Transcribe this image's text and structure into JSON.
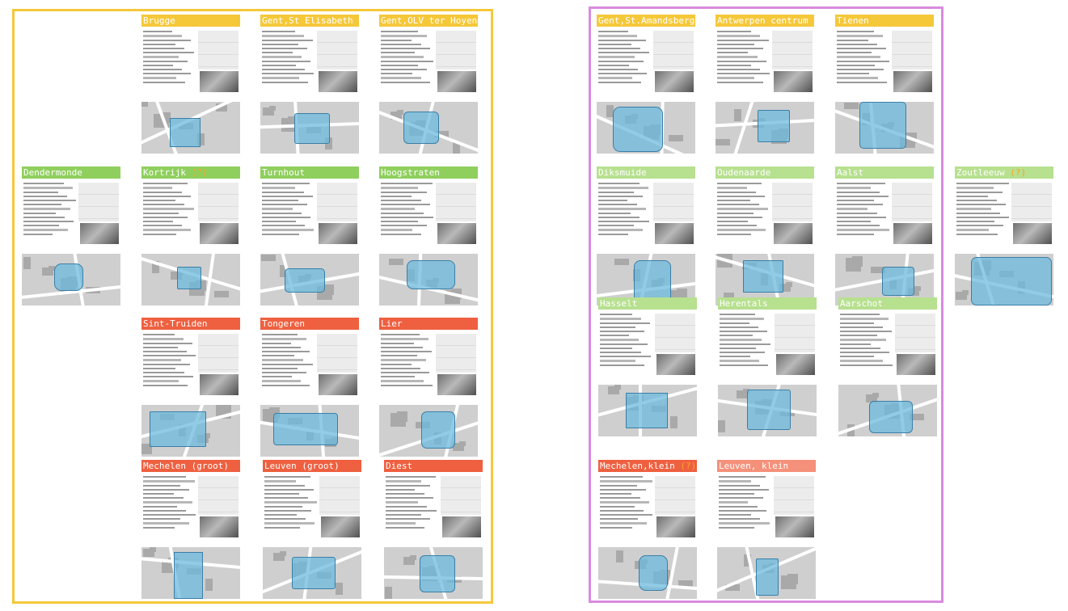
{
  "colors": {
    "yellow": "#f5c83a",
    "green": "#8fcf5e",
    "lightgreen": "#b7e08f",
    "red": "#ee6040",
    "salmon": "#f5907a",
    "frame_left": "#f5c83a",
    "frame_right": "#d98be0",
    "question": "#f5a623"
  },
  "cards": [
    {
      "name": "Brugge",
      "q": "",
      "color": "yellow"
    },
    {
      "name": "Gent,St Elisabeth",
      "q": "",
      "color": "yellow"
    },
    {
      "name": "Gent,OLV ter Hoyen",
      "q": "",
      "color": "yellow"
    },
    {
      "name": "Dendermonde",
      "q": "",
      "color": "green"
    },
    {
      "name": "Kortrijk ",
      "q": "(?)",
      "color": "green"
    },
    {
      "name": "Turnhout",
      "q": "",
      "color": "green"
    },
    {
      "name": "Hoogstraten",
      "q": "",
      "color": "green"
    },
    {
      "name": "Sint-Truiden",
      "q": "",
      "color": "red"
    },
    {
      "name": "Tongeren",
      "q": "",
      "color": "red"
    },
    {
      "name": "Lier",
      "q": "",
      "color": "red"
    },
    {
      "name": "Mechelen (groot)",
      "q": "",
      "color": "red"
    },
    {
      "name": "Leuven (groot)",
      "q": "",
      "color": "red"
    },
    {
      "name": "Diest",
      "q": "",
      "color": "red"
    },
    {
      "name": "Gent,St.Amandsberg",
      "q": "",
      "color": "yellow"
    },
    {
      "name": "Antwerpen centrum",
      "q": "",
      "color": "yellow"
    },
    {
      "name": "Tienen",
      "q": "",
      "color": "yellow"
    },
    {
      "name": "Diksmuide",
      "q": "",
      "color": "lightgreen"
    },
    {
      "name": "Oudenaarde",
      "q": "",
      "color": "lightgreen"
    },
    {
      "name": "Aalst",
      "q": "",
      "color": "lightgreen"
    },
    {
      "name": "Zoutleeuw ",
      "q": "(?)",
      "color": "lightgreen"
    },
    {
      "name": "Hasselt",
      "q": "",
      "color": "lightgreen"
    },
    {
      "name": "Herentals",
      "q": "",
      "color": "lightgreen"
    },
    {
      "name": "Aarschot",
      "q": "",
      "color": "lightgreen"
    },
    {
      "name": "Mechelen,klein ",
      "q": "(?)",
      "color": "red"
    },
    {
      "name": "Leuven, klein",
      "q": "",
      "color": "salmon"
    }
  ]
}
